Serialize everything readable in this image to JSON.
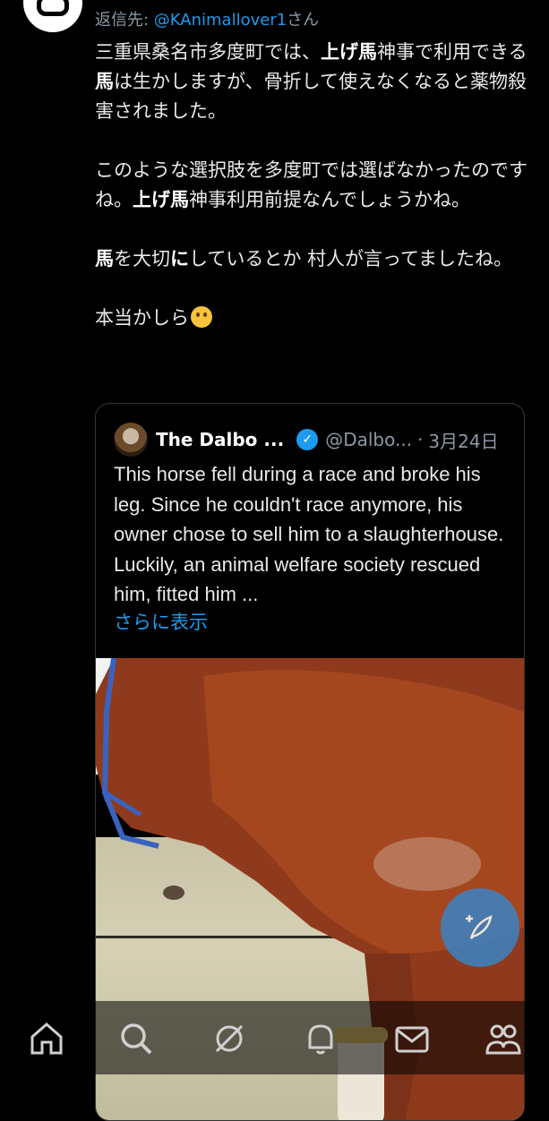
{
  "reply": {
    "prefix": "返信先: ",
    "handle": "@KAnimallover1",
    "suffix": "さん"
  },
  "tweet": {
    "p1_a": "三重県桑名市多度町では、",
    "p1_b": "上げ馬",
    "p1_c": "神事で利用できる",
    "p1_d": "馬",
    "p1_e": "は生かしますが、骨折して使えなくなると薬物殺害されました。",
    "p2_a": "このような選択肢を多度町では選ばなかったのですね。",
    "p2_b": "上げ馬",
    "p2_c": "神事利用前提なんでしょうかね。",
    "p3_a": "馬",
    "p3_b": "を大切",
    "p3_c": "に",
    "p3_d": "している",
    "p3_e": "とか 村人が言ってましたね。",
    "p4": "本当かしら",
    "emoji": "thinking-face"
  },
  "quote": {
    "name": "The Dalbo ...",
    "handle": "@Dalbo...",
    "dot": "·",
    "date": "3月24日",
    "text": "This horse fell during a race and broke his leg. Since he couldn't race anymore, his owner chose to sell him to a slaughterhouse. Luckily, an animal welfare society rescued him, fitted him ...",
    "more": "さらに表示",
    "media": "photo of a chestnut horse with a blue halter on grass"
  },
  "fab": {
    "icon": "compose-feather-icon"
  },
  "nav": {
    "items": [
      "home-icon",
      "search-icon",
      "grok-icon",
      "notifications-icon",
      "messages-icon",
      "communities-icon"
    ]
  },
  "colors": {
    "accent": "#1d9bf0",
    "background": "#000000",
    "muted": "#8b98a5"
  }
}
